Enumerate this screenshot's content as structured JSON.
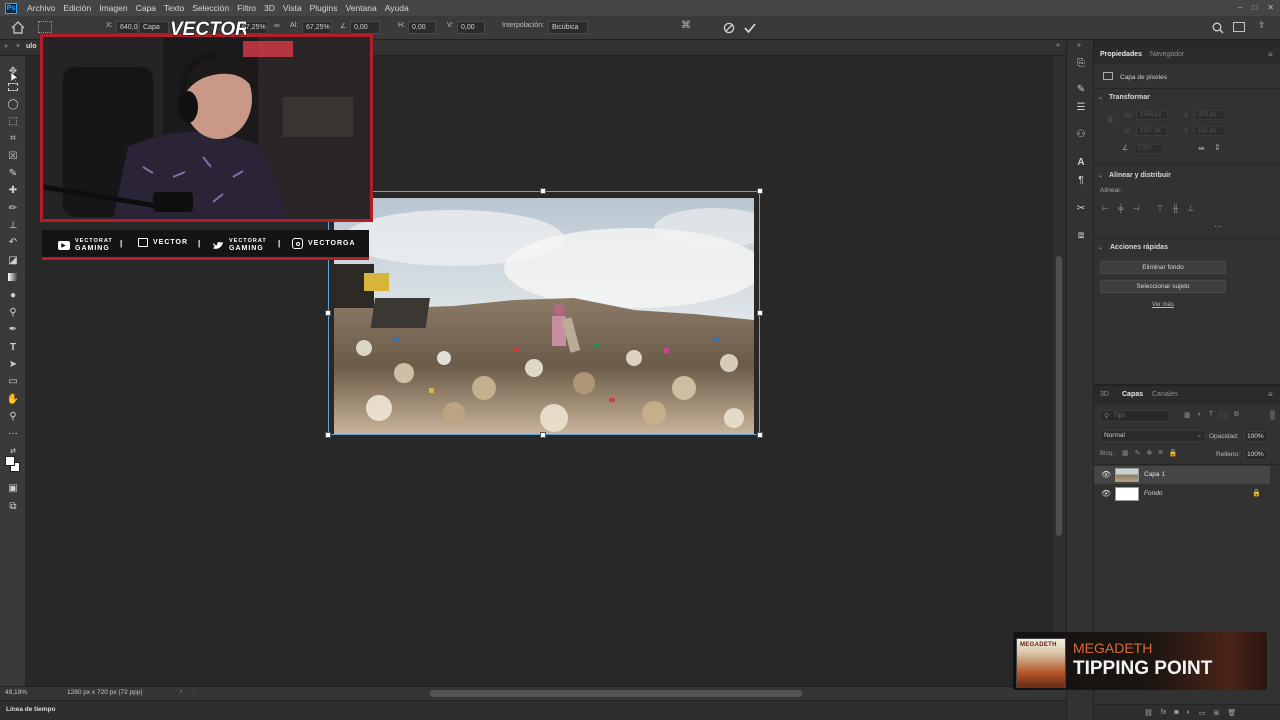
{
  "menu": [
    "Archivo",
    "Edición",
    "Imagen",
    "Capa",
    "Texto",
    "Selección",
    "Filtro",
    "3D",
    "Vista",
    "Plugins",
    "Ventana",
    "Ayuda"
  ],
  "options": {
    "x_label": "X:",
    "x_value": "640,0",
    "ref": "Capa",
    "w_value": "67,25%",
    "h_label": "Al:",
    "h_value": "67,25%",
    "angle_value": "0,00",
    "hskew_label": "H:",
    "hskew_value": "0,00",
    "vskew_label": "V:",
    "vskew_value": "0,00",
    "interp_label": "Interpolación:",
    "interp_value": "Bicúbica"
  },
  "tab": {
    "title": "ulo"
  },
  "overlay": {
    "logo_text": "VECTOR",
    "socials": [
      {
        "icon": "youtube-icon",
        "line1": "VECTORAT",
        "line2": "GAMING"
      },
      {
        "icon": "twitch-icon",
        "text": "VECTOR"
      },
      {
        "icon": "twitter-icon",
        "line1": "VECTORAT",
        "line2": "GAMING"
      },
      {
        "icon": "instagram-icon",
        "text": "VECTORGA"
      }
    ],
    "now_playing": {
      "artist": "MEGADETH",
      "song": "TIPPING POINT",
      "cover_label": "MEGADETH"
    }
  },
  "properties": {
    "tab_active": "Propiedades",
    "tab_inactive": "Navegador",
    "layer_type": "Capa de píxeles",
    "transform_title": "Transformar",
    "w_label": "An",
    "w_value": "1560 px",
    "x_label": "X",
    "x_value": "378 px",
    "h_label": "Al",
    "h_value": "1107 px",
    "y_label": "Y",
    "y_value": "182 px",
    "angle_value": "0,00°",
    "align_title": "Alinear y distribuir",
    "align_label": "Alinear:",
    "quick_title": "Acciones rápidas",
    "btn_remove_bg": "Eliminar fondo",
    "btn_select_subject": "Seleccionar sujeto",
    "see_more": "Ver más"
  },
  "layers": {
    "tabs": [
      "3D",
      "Capas",
      "Canales"
    ],
    "active_tab": "Capas",
    "search_placeholder": "Tipo",
    "blend_mode": "Normal",
    "opacity_label": "Opacidad:",
    "opacity_value": "100%",
    "lock_label": "Bloq.:",
    "fill_label": "Relleno:",
    "fill_value": "100%",
    "items": [
      {
        "name": "Capa 1",
        "selected": true
      },
      {
        "name": "Fondo",
        "selected": false,
        "locked": true
      }
    ]
  },
  "status": {
    "zoom": "49,19%",
    "doc_info": "1280 px x 720 px (72 ppp)"
  },
  "timeline": {
    "label": "Línea de tiempo"
  },
  "colors": {
    "accent_red": "#b41d2a",
    "ps_blue": "#31a8ff"
  }
}
